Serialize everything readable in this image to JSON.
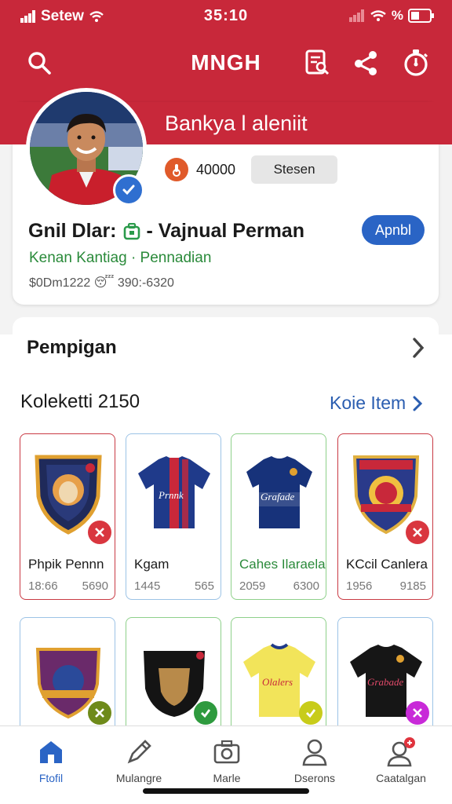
{
  "status_bar": {
    "carrier": "Setew",
    "time": "35:10",
    "battery": "%"
  },
  "header": {
    "title": "MNGH"
  },
  "header_icons": [
    "search-icon",
    "document-search-icon",
    "share-icon",
    "stopwatch-icon"
  ],
  "profile": {
    "banner_name": "Bankya l aleniit",
    "coins": "40000",
    "status_button": "Stesen",
    "full_name_prefix": "Gnil Dlar:",
    "full_name_suffix": "- Vajnual Perman",
    "club_line": "Kenan Kantiag · Pennadian",
    "meta_line": "$0Dm1222 😴 390:-6320",
    "apply_button": "Apnbl"
  },
  "section": {
    "title": "Pempigan"
  },
  "collection": {
    "title": "Koleketti 2150",
    "link": "Koie Item",
    "items": [
      {
        "name": "Phpik Pennn",
        "stat1": "18:66",
        "stat2": "5690",
        "kind": "badge-crest",
        "status": "remove"
      },
      {
        "name": "Kgam",
        "stat1": "1445",
        "stat2": "565",
        "kind": "jersey-blue-red",
        "status": "none"
      },
      {
        "name": "Cahes Ilaraela",
        "stat1": "2059",
        "stat2": "6300",
        "kind": "jersey-blue",
        "status": "none"
      },
      {
        "name": "KCcil Canlera",
        "stat1": "1956",
        "stat2": "9185",
        "kind": "badge-crest-gold",
        "status": "remove"
      },
      {
        "name": "",
        "stat1": "",
        "stat2": "",
        "kind": "badge-purple",
        "status": "check-olive"
      },
      {
        "name": "",
        "stat1": "",
        "stat2": "",
        "kind": "badge-black",
        "status": "check-green"
      },
      {
        "name": "",
        "stat1": "",
        "stat2": "",
        "kind": "jersey-yellow",
        "status": "check-yellow"
      },
      {
        "name": "",
        "stat1": "",
        "stat2": "",
        "kind": "jersey-black",
        "status": "remove-purple"
      }
    ]
  },
  "tabs": [
    {
      "label": "Ftofil",
      "icon": "home-icon",
      "active": true
    },
    {
      "label": "Mulangre",
      "icon": "edit-icon",
      "active": false
    },
    {
      "label": "Marle",
      "icon": "camera-icon",
      "active": false
    },
    {
      "label": "Dserons",
      "icon": "user-icon",
      "active": false
    },
    {
      "label": "Caatalgan",
      "icon": "user-notification-icon",
      "active": false
    }
  ],
  "colors": {
    "brand_red": "#c8283a",
    "accent_blue": "#2a64c5",
    "success_green": "#2a8a3a"
  }
}
